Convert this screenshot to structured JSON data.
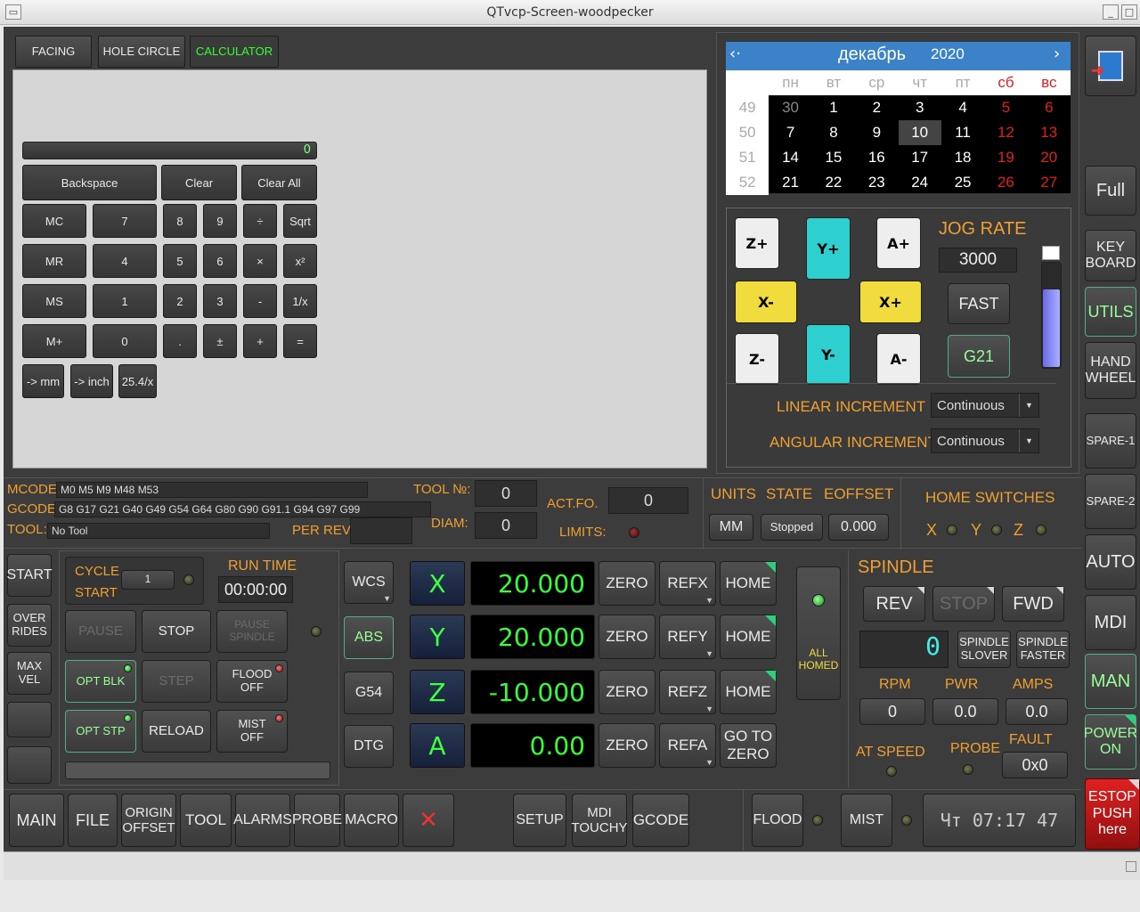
{
  "window": {
    "title": "QTvcp-Screen-woodpecker"
  },
  "tabs": {
    "facing": "FACING",
    "hole_circle": "HOLE CIRCLE",
    "calculator": "CALCULATOR"
  },
  "calculator": {
    "display": "0",
    "backspace": "Backspace",
    "clear": "Clear",
    "clear_all": "Clear All",
    "rows": [
      [
        "MC",
        "7",
        "8",
        "9",
        "÷",
        "Sqrt"
      ],
      [
        "MR",
        "4",
        "5",
        "6",
        "×",
        "x²"
      ],
      [
        "MS",
        "1",
        "2",
        "3",
        "-",
        "1/x"
      ],
      [
        "M+",
        "0",
        ".",
        "±",
        "+",
        "="
      ]
    ],
    "to_mm": "-> mm",
    "to_inch": "-> inch",
    "conv": "25.4/x"
  },
  "calendar": {
    "month": "декабрь",
    "year": "2020",
    "weekdays": [
      "пн",
      "вт",
      "ср",
      "чт",
      "пт",
      "сб",
      "вс"
    ],
    "weeks": [
      {
        "num": "49",
        "days": [
          "30",
          "1",
          "2",
          "3",
          "4",
          "5",
          "6"
        ]
      },
      {
        "num": "50",
        "days": [
          "7",
          "8",
          "9",
          "10",
          "11",
          "12",
          "13"
        ]
      },
      {
        "num": "51",
        "days": [
          "14",
          "15",
          "16",
          "17",
          "18",
          "19",
          "20"
        ]
      },
      {
        "num": "52",
        "days": [
          "21",
          "22",
          "23",
          "24",
          "25",
          "26",
          "27"
        ]
      }
    ],
    "selected": "10"
  },
  "jog": {
    "buttons": {
      "z_plus": "Z+",
      "y_plus": "Y+",
      "a_plus": "A+",
      "x_minus": "X-",
      "x_plus": "X+",
      "z_minus": "Z-",
      "y_minus": "Y-",
      "a_minus": "A-"
    },
    "rate_label": "JOG RATE",
    "rate": "3000",
    "fast": "FAST",
    "g21": "G21",
    "slider_fraction": 0.75,
    "linear_label": "LINEAR INCREMENT",
    "linear_value": "Continuous",
    "angular_label": "ANGULAR INCREMENT",
    "angular_value": "Continuous"
  },
  "right_bar": {
    "full": "Full",
    "keyboard": "KEY\nBOARD",
    "utils": "UTILS",
    "handwheel": "HAND\nWHEEL",
    "spare1": "SPARE-1",
    "spare2": "SPARE-2",
    "auto": "AUTO",
    "mdi": "MDI",
    "man": "MAN",
    "power": "POWER\nON",
    "estop": "ESTOP\nPUSH\nhere"
  },
  "status": {
    "mcodes_label": "MCODES",
    "mcodes": "M0 M5 M9 M48 M53",
    "gcodes_label": "GCODES:",
    "gcodes": "G8 G17 G21 G40 G49 G54 G64 G80 G90 G91.1 G94 G97 G99",
    "tool_label": "TOOL:",
    "tool": "No Tool",
    "tool_no_label": "TOOL №:",
    "tool_no": "0",
    "diam_label": "DIAM:",
    "diam": "0",
    "per_rev_label": "PER REV:",
    "actfo_label": "ACT.FO.",
    "actfo": "0",
    "limits_label": "LIMITS:",
    "units_label": "UNITS",
    "units": "MM",
    "state_label": "STATE",
    "state": "Stopped",
    "eoffset_label": "EOFFSET",
    "eoffset": "0.000",
    "home_switches_label": "HOME SWITCHES",
    "x": "X",
    "y": "Y",
    "z": "Z"
  },
  "left_buttons": {
    "start": "START",
    "overrides": "OVER\nRIDES",
    "maxvel": "MAX\nVEL"
  },
  "cycle": {
    "cycle_start": "CYCLE\nSTART",
    "count": "1",
    "run_time_label": "RUN TIME",
    "run_time": "00:00:00",
    "pause": "PAUSE",
    "stop": "STOP",
    "pause_spindle": "PAUSE\nSPINDLE",
    "opt_blk": "OPT BLK",
    "step": "STEP",
    "flood_off": "FLOOD\nOFF",
    "opt_stp": "OPT STP",
    "reload": "RELOAD",
    "mist_off": "MIST\nOFF"
  },
  "wcs": {
    "wcs": "WCS",
    "abs": "ABS",
    "g54": "G54",
    "dtg": "DTG"
  },
  "dro": [
    {
      "axis": "X",
      "value": "20.000",
      "ref": "REFX",
      "home": "HOME"
    },
    {
      "axis": "Y",
      "value": "20.000",
      "ref": "REFY",
      "home": "HOME"
    },
    {
      "axis": "Z",
      "value": "-10.000",
      "ref": "REFZ",
      "home": "HOME"
    },
    {
      "axis": "A",
      "value": "0.00",
      "ref": "REFA",
      "home": "GO TO\nZERO"
    }
  ],
  "zero": "ZERO",
  "all_homed": "ALL\nHOMED",
  "spindle": {
    "title": "SPINDLE",
    "rev": "REV",
    "stop": "STOP",
    "fwd": "FWD",
    "speed": "0",
    "slower": "SPINDLE\nSLOVER",
    "faster": "SPINDLE\nFASTER",
    "rpm_label": "RPM",
    "rpm": "0",
    "pwr_label": "PWR",
    "pwr": "0.0",
    "amps_label": "AMPS",
    "amps": "0.0",
    "at_speed": "AT SPEED",
    "probe": "PROBE",
    "fault_label": "FAULT",
    "fault": "0x0"
  },
  "bottom": {
    "main": "MAIN",
    "file": "FILE",
    "origin_offset": "ORIGIN\nOFFSET",
    "tool": "TOOL",
    "alarms": "ALARMS",
    "probe": "PROBE",
    "macro": "MACRO",
    "setup": "SETUP",
    "mdi_touchy": "MDI\nTOUCHY",
    "gcode": "GCODE",
    "flood": "FLOOD",
    "mist": "MIST",
    "clock": "Чт 07:17 47"
  },
  "colors": {
    "orange": "#f0a030",
    "dro_green": "#33ff33",
    "cyan": "#2ecfcf",
    "yellow": "#f0dc3c",
    "calendar_blue": "#3c82c8",
    "weekend_red": "#e02020"
  }
}
